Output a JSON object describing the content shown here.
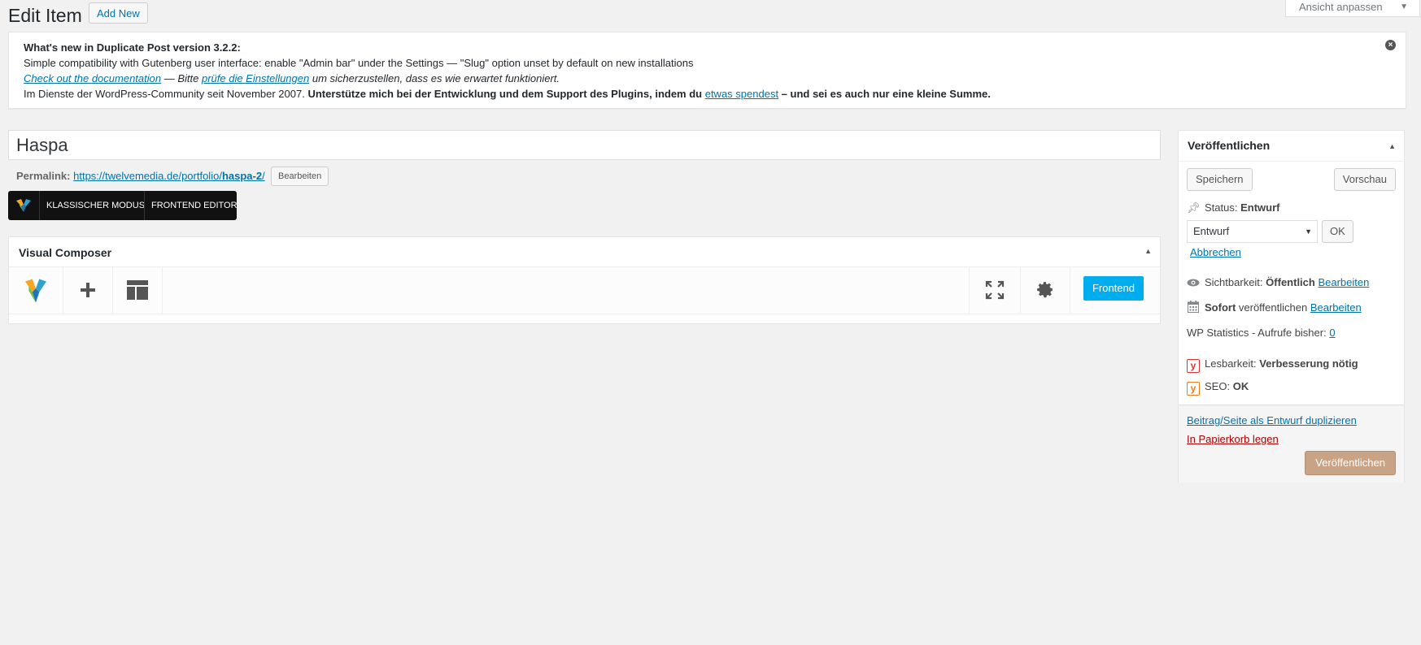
{
  "header": {
    "title": "Edit Item",
    "add_new": "Add New",
    "screen_options": "Ansicht anpassen"
  },
  "notice": {
    "title": "What's new in Duplicate Post version 3.2.2:",
    "line2": "Simple compatibility with Gutenberg user interface: enable \"Admin bar\" under the Settings — \"Slug\" option unset by default on new installations",
    "line3_link1": "Check out the documentation",
    "line3_mid": " — Bitte ",
    "line3_link2": "prüfe die Einstellungen",
    "line3_end": " um sicherzustellen, dass es wie erwartet funktioniert.",
    "line4_start": "Im Dienste der WordPress-Community seit November 2007. ",
    "line4_bold": "Unterstütze mich bei der Entwicklung und dem Support des Plugins, indem du ",
    "line4_link": "etwas spendest",
    "line4_end": " – und sei es auch nur eine kleine Summe."
  },
  "post": {
    "title": "Haspa",
    "permalink_label": "Permalink:",
    "permalink_base": "https://twelvemedia.de/portfolio/",
    "permalink_slug": "haspa-2",
    "permalink_trail": "/",
    "permalink_edit": "Bearbeiten"
  },
  "vc_modebar": {
    "classic": "KLASSISCHER MODUS",
    "frontend": "FRONTEND EDITOR"
  },
  "vc_panel": {
    "title": "Visual Composer",
    "frontend_button": "Frontend",
    "icons": [
      "vc-logo-icon",
      "add-element-icon",
      "templates-icon",
      "fullscreen-icon",
      "settings-gear-icon"
    ]
  },
  "publish": {
    "title": "Veröffentlichen",
    "save": "Speichern",
    "preview": "Vorschau",
    "status_label": "Status:",
    "status_value": "Entwurf",
    "status_select": "Entwurf",
    "ok": "OK",
    "cancel": "Abbrechen",
    "visibility_label": "Sichtbarkeit:",
    "visibility_value": "Öffentlich",
    "visibility_edit": "Bearbeiten",
    "schedule_bold": "Sofort",
    "schedule_text": " veröffentlichen",
    "schedule_edit": "Bearbeiten",
    "wp_stats_label": "WP Statistics - Aufrufe bisher:",
    "wp_stats_value": "0",
    "readability_label": "Lesbarkeit:",
    "readability_value": "Verbesserung nötig",
    "seo_label": "SEO:",
    "seo_value": "OK",
    "duplicate_link": "Beitrag/Seite als Entwurf duplizieren",
    "trash_link": "In Papierkorb legen",
    "publish_button": "Veröffentlichen"
  },
  "colors": {
    "accent": "#0073aa",
    "vc_frontend": "#00aeef",
    "publish_button": "#c8a386",
    "trash": "#a00",
    "readability_icon": "#dc3232",
    "seo_icon": "#ee7c1b"
  }
}
